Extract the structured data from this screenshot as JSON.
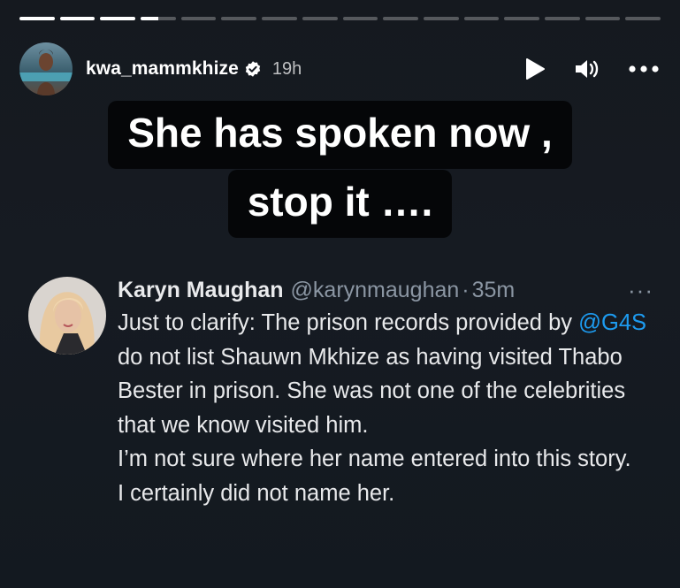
{
  "story": {
    "progress_segments": 16,
    "progress_completed": 3,
    "progress_active_fraction": 0.5,
    "username": "kwa_mammkhize",
    "time": "19h",
    "icons": [
      "avatar",
      "verified-badge-icon",
      "play-icon",
      "volume-icon",
      "more-icon"
    ]
  },
  "caption": {
    "line1": "She has spoken now ,",
    "line2": "stop it …."
  },
  "tweet": {
    "name": "Karyn Maughan",
    "handle": "@karynmaughan",
    "separator": "·",
    "time": "35m",
    "more": "···",
    "mention": "@G4S",
    "text_before_mention": "Just to clarify: The prison records provided by",
    "text_after_mention": " do not list Shauwn Mkhize as having visited Thabo Bester in prison. She was not one of the celebrities that we know visited him.",
    "line2": "I’m not sure where her name entered into this story.",
    "line3": "I certainly did not name her.",
    "mention_color": "#1d9bf0"
  }
}
